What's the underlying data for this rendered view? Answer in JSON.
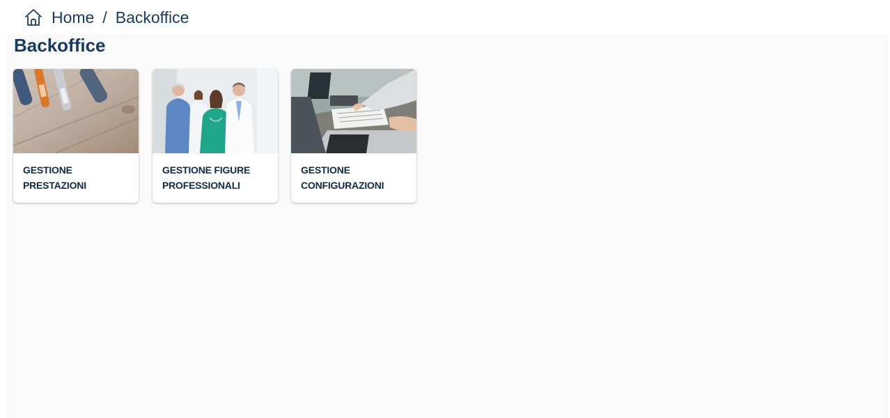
{
  "breadcrumb": {
    "home_icon": "home-icon",
    "items": [
      "Home",
      "Backoffice"
    ],
    "separator": "/"
  },
  "page": {
    "title": "Backoffice"
  },
  "cards": [
    {
      "label": "GESTIONE PRESTAZIONI",
      "image": "insulin-pens-photo"
    },
    {
      "label": "GESTIONE FIGURE PROFESSIONALI",
      "image": "medical-staff-photo"
    },
    {
      "label": "GESTIONE CONFIGURAZIONI",
      "image": "laptop-meeting-photo"
    }
  ],
  "colors": {
    "primary_text": "#173a5e",
    "card_text": "#102a43",
    "background": "#fafafa",
    "card_background": "#ffffff"
  }
}
